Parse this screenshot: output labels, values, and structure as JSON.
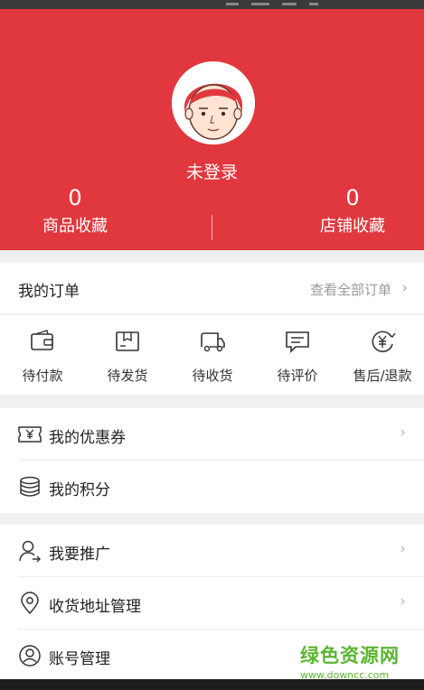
{
  "header": {
    "login_status": "未登录",
    "stats": [
      {
        "count": "0",
        "label": "商品收藏"
      },
      {
        "count": "0",
        "label": "店铺收藏"
      }
    ],
    "color": "#e0383e"
  },
  "orders": {
    "title": "我的订单",
    "view_all": "查看全部订单",
    "items": [
      {
        "label": "待付款",
        "icon": "wallet-icon"
      },
      {
        "label": "待发货",
        "icon": "package-icon"
      },
      {
        "label": "待收货",
        "icon": "truck-icon"
      },
      {
        "label": "待评价",
        "icon": "comment-icon"
      },
      {
        "label": "售后/退款",
        "icon": "refund-icon"
      }
    ]
  },
  "menu1": [
    {
      "label": "我的优惠券",
      "icon": "coupon-icon"
    },
    {
      "label": "我的积分",
      "icon": "coins-icon"
    }
  ],
  "menu2": [
    {
      "label": "我要推广",
      "icon": "user-icon"
    },
    {
      "label": "收货地址管理",
      "icon": "location-icon"
    },
    {
      "label": "账号管理",
      "icon": "account-icon"
    }
  ],
  "watermark": {
    "title": "绿色资源网",
    "url": "www.downcc.com"
  }
}
